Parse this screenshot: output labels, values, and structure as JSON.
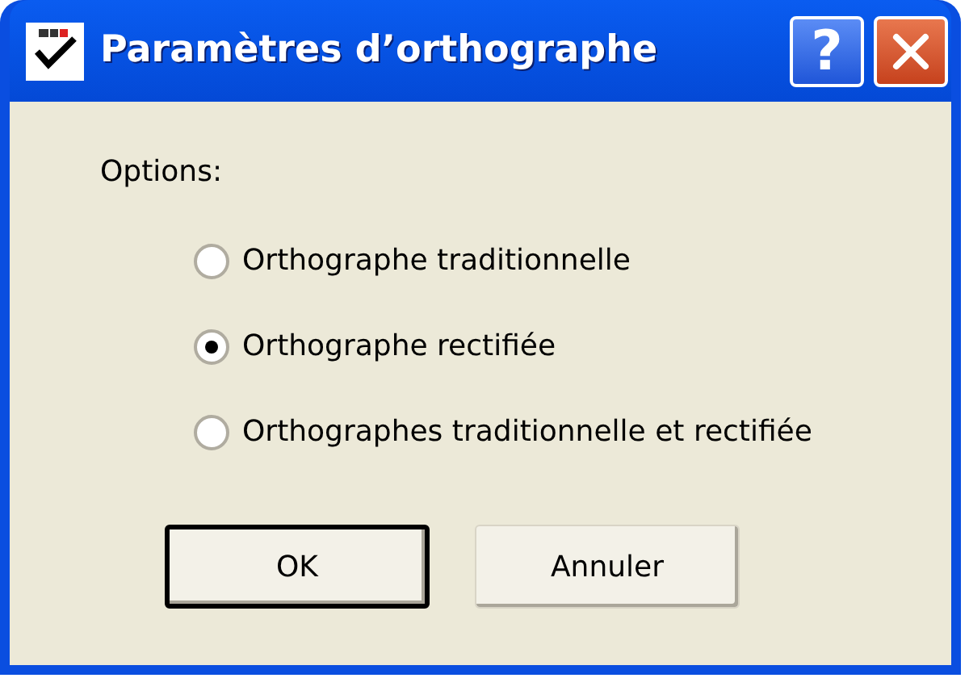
{
  "window": {
    "title": "Paramètres d’orthographe"
  },
  "title_buttons": [
    {
      "kind": "help",
      "label": "?"
    },
    {
      "kind": "close"
    }
  ],
  "options_label": "Options:",
  "options": [
    {
      "label": "Orthographe traditionnelle",
      "selected": false
    },
    {
      "label": "Orthographe rectifiée",
      "selected": true
    },
    {
      "label": "Orthographes traditionnelle et rectifiée",
      "selected": false
    }
  ],
  "buttons": [
    {
      "label": "OK",
      "default": true
    },
    {
      "label": "Annuler",
      "default": false
    }
  ]
}
